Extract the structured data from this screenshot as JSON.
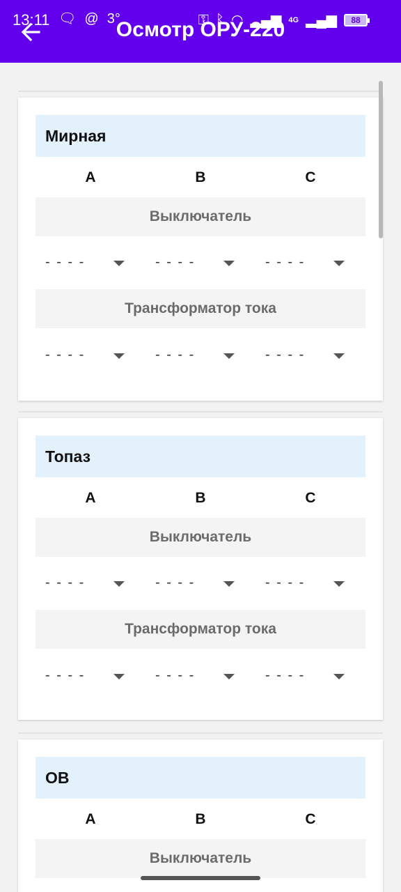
{
  "status_bar": {
    "time": "13:11",
    "extra": "3°",
    "network_label": "4G",
    "battery": "88"
  },
  "app_bar": {
    "title": "Осмотр ОРУ-220"
  },
  "cards": [
    {
      "title": "Мирная",
      "phases": [
        "A",
        "B",
        "C"
      ],
      "sections": [
        {
          "label": "Выключатель",
          "values": [
            "- - - -",
            "- - - -",
            "- - - -"
          ]
        },
        {
          "label": "Трансформатор тока",
          "values": [
            "- - - -",
            "- - - -",
            "- - - -"
          ]
        }
      ]
    },
    {
      "title": "Топаз",
      "phases": [
        "A",
        "B",
        "C"
      ],
      "sections": [
        {
          "label": "Выключатель",
          "values": [
            "- - - -",
            "- - - -",
            "- - - -"
          ]
        },
        {
          "label": "Трансформатор тока",
          "values": [
            "- - - -",
            "- - - -",
            "- - - -"
          ]
        }
      ]
    },
    {
      "title": "ОВ",
      "phases": [
        "A",
        "B",
        "C"
      ],
      "sections": [
        {
          "label": "Выключатель"
        }
      ]
    }
  ]
}
